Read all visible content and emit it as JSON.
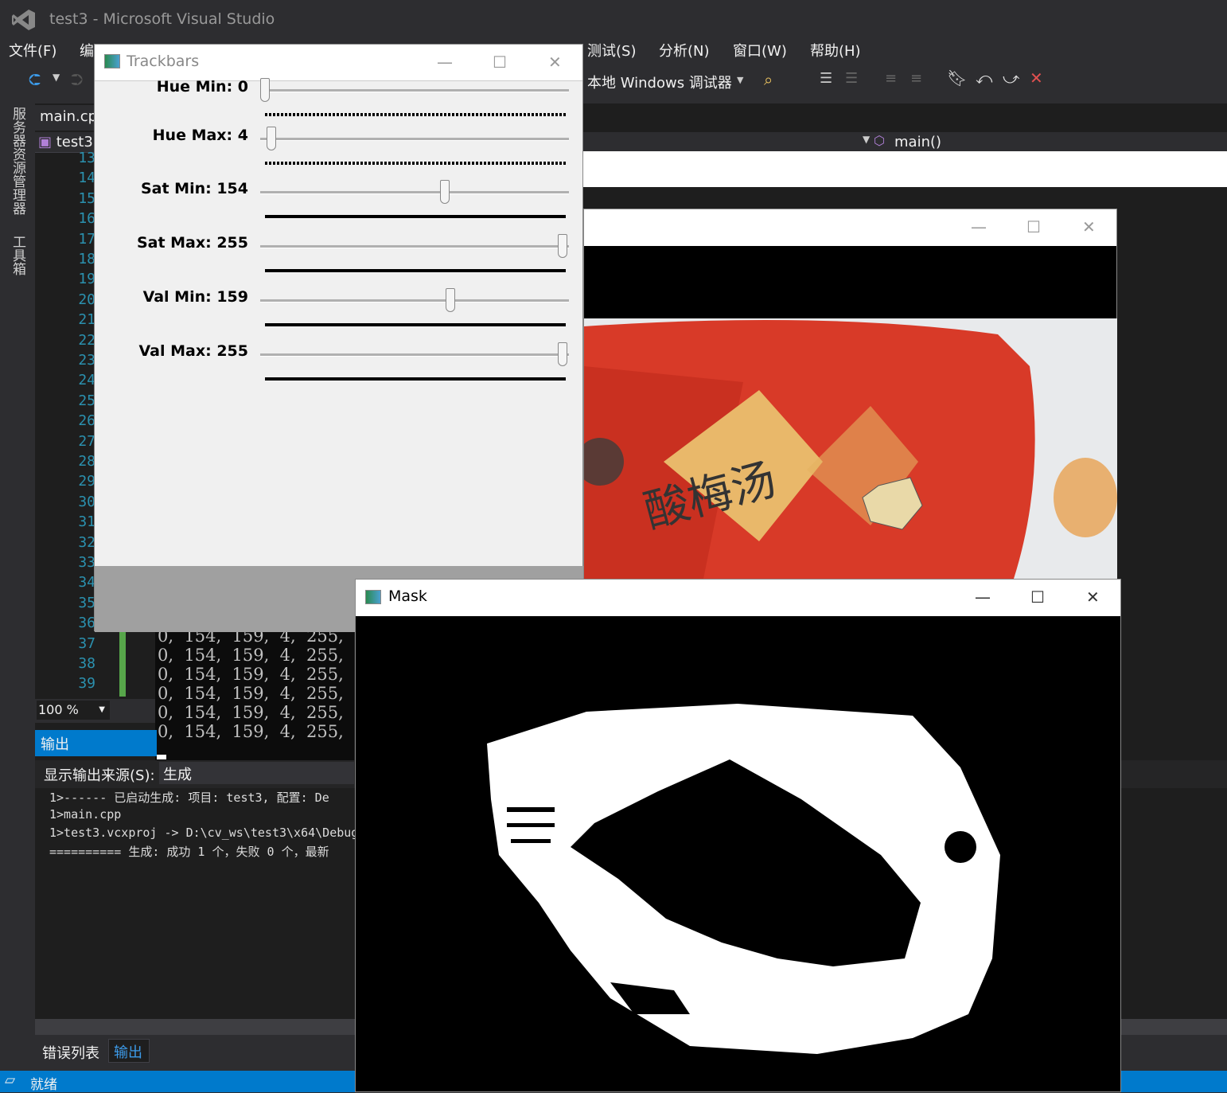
{
  "window_title": "test3 - Microsoft Visual Studio",
  "menu": [
    "文件(F)",
    "编",
    "测试(S)",
    "分析(N)",
    "窗口(W)",
    "帮助(H)"
  ],
  "toolbar": {
    "debugger": "本地 Windows 调试器"
  },
  "side_tabs": [
    "服务器资源管理器",
    "工具箱"
  ],
  "editor": {
    "tab": "main.cp",
    "project": "test3",
    "function": "main()",
    "zoom": "100 %",
    "line_numbers": [
      "13",
      "14",
      "15",
      "16",
      "17",
      "18",
      "19",
      "20",
      "21",
      "22",
      "23",
      "24",
      "25",
      "26",
      "27",
      "28",
      "29",
      "30",
      "31",
      "32",
      "33",
      "34",
      "35",
      "36",
      "37",
      "38",
      "39"
    ]
  },
  "trackbars": {
    "title": "Trackbars",
    "items": [
      {
        "label": "Hue Min: 0",
        "value": 0,
        "max": 179
      },
      {
        "label": "Hue Max: 4",
        "value": 4,
        "max": 179
      },
      {
        "label": "Sat Min: 154",
        "value": 154,
        "max": 255
      },
      {
        "label": "Sat Max: 255",
        "value": 255,
        "max": 255
      },
      {
        "label": "Val Min: 159",
        "value": 159,
        "max": 255
      },
      {
        "label": "Val Max: 255",
        "value": 255,
        "max": 255
      }
    ]
  },
  "console_rows": [
    "0,  154,  159,  4,  255,",
    "0,  154,  159,  4,  255,",
    "0,  154,  159,  4,  255,",
    "0,  154,  159,  4,  255,",
    "0,  154,  159,  4,  255,",
    "0,  154,  159,  4,  255,"
  ],
  "image_window": {
    "title": ""
  },
  "mask_window": {
    "title": "Mask"
  },
  "output": {
    "header": "输出",
    "source_label": "显示输出来源(S):",
    "source_value": "生成",
    "lines": [
      "1>------ 已启动生成: 项目: test3, 配置: De",
      "1>main.cpp",
      "1>test3.vcxproj -> D:\\cv_ws\\test3\\x64\\Debug",
      "========== 生成: 成功 1 个，失败 0 个，最新"
    ]
  },
  "bottom_tabs": [
    "错误列表",
    "输出"
  ],
  "status": "就绪",
  "colors": {
    "accent": "#007acc",
    "bg": "#2d2d30",
    "editor": "#1e1e1e"
  }
}
